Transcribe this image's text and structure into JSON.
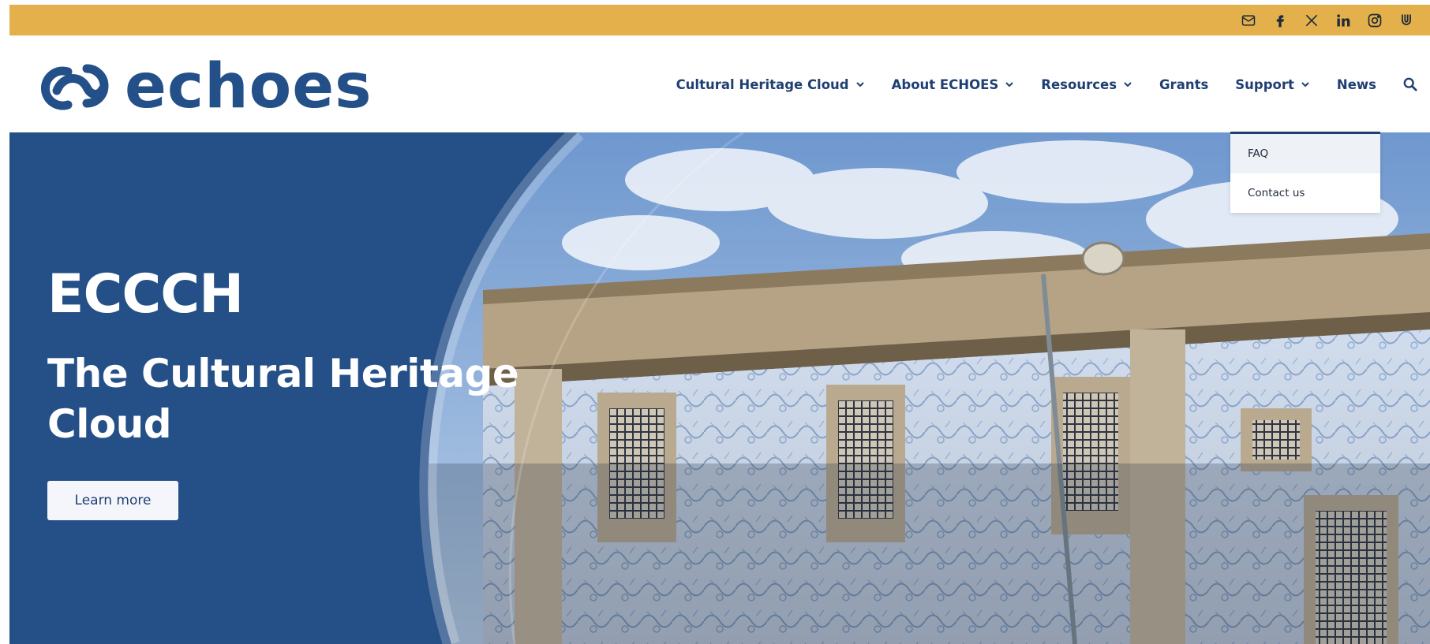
{
  "topbar": {
    "bg_color": "#e3b04b",
    "icons": [
      {
        "name": "mail-icon"
      },
      {
        "name": "facebook-icon"
      },
      {
        "name": "x-twitter-icon"
      },
      {
        "name": "linkedin-icon"
      },
      {
        "name": "instagram-icon"
      },
      {
        "name": "untappd-icon"
      }
    ]
  },
  "header": {
    "logo_text": "echoes",
    "brand_color": "#235089",
    "nav": {
      "items": [
        {
          "label": "Cultural Heritage Cloud",
          "has_dropdown": true
        },
        {
          "label": "About ECHOES",
          "has_dropdown": true
        },
        {
          "label": "Resources",
          "has_dropdown": true
        },
        {
          "label": "Grants",
          "has_dropdown": false
        },
        {
          "label": "Support",
          "has_dropdown": true
        },
        {
          "label": "News",
          "has_dropdown": false
        }
      ],
      "search_icon": "search-icon"
    }
  },
  "support_dropdown": {
    "options": [
      "FAQ",
      "Contact us"
    ]
  },
  "hero": {
    "bg_color": "#244f87",
    "kicker": "ECCCH",
    "headline": "The Cultural Heritage Cloud",
    "cta_label": "Learn more"
  }
}
